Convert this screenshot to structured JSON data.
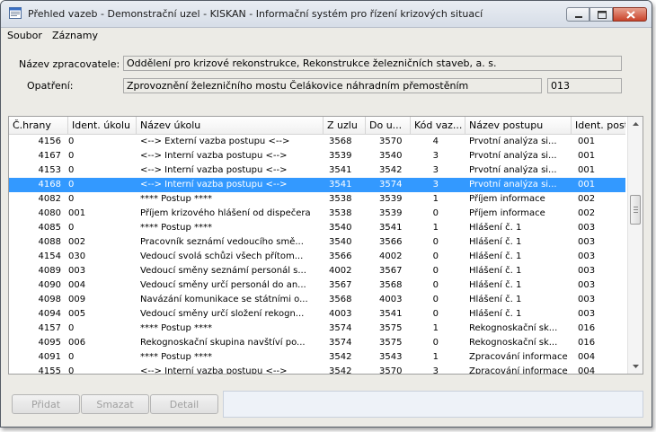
{
  "window": {
    "title": "Přehled vazeb - Demonstrační uzel - KISKAN - Informační systém pro řízení krizových situací"
  },
  "menu": {
    "items": [
      "Soubor",
      "Záznamy"
    ]
  },
  "form": {
    "zpracovatel_label": "Název zpracovatele:",
    "zpracovatel_value": "Oddělení pro krizové rekonstrukce, Rekonstrukce železničních staveb, a. s.",
    "opatreni_label": "Opatření:",
    "opatreni_value": "Zprovoznění železničního mostu Čelákovice náhradním přemostěním",
    "opatreni_code": "013"
  },
  "grid": {
    "columns": [
      "Č.hrany",
      "Ident. úkolu",
      "Název úkolu",
      "Z uzlu",
      "Do u...",
      "Kód vaz...",
      "Název postupu",
      "Ident. post"
    ],
    "selected_row": 3,
    "rows": [
      [
        "4156",
        "0",
        "<--> Externí vazba postupu <-->",
        "3568",
        "3570",
        "4",
        "Prvotní analýza si...",
        "001"
      ],
      [
        "4167",
        "0",
        "<--> Interní vazba postupu <-->",
        "3539",
        "3540",
        "3",
        "Prvotní analýza si...",
        "001"
      ],
      [
        "4153",
        "0",
        "<--> Interní vazba postupu <-->",
        "3541",
        "3542",
        "3",
        "Prvotní analýza si...",
        "001"
      ],
      [
        "4168",
        "0",
        "<--> Interní vazba postupu <-->",
        "3541",
        "3574",
        "3",
        "Prvotní analýza si...",
        "001"
      ],
      [
        "4082",
        "0",
        "**** Postup ****",
        "3538",
        "3539",
        "1",
        "Příjem informace",
        "002"
      ],
      [
        "4080",
        "001",
        "Příjem krizového hlášení od dispečera",
        "3538",
        "3539",
        "0",
        "Příjem informace",
        "002"
      ],
      [
        "4085",
        "0",
        "**** Postup ****",
        "3540",
        "3541",
        "1",
        "Hlášení č. 1",
        "003"
      ],
      [
        "4088",
        "002",
        "Pracovník seznámí vedoucího smě...",
        "3540",
        "3566",
        "0",
        "Hlášení č. 1",
        "003"
      ],
      [
        "4154",
        "030",
        "Vedoucí svolá schůzi všech přítom...",
        "3566",
        "4002",
        "0",
        "Hlášení č. 1",
        "003"
      ],
      [
        "4089",
        "003",
        "Vedoucí směny seznámí personál s...",
        "4002",
        "3567",
        "0",
        "Hlášení č. 1",
        "003"
      ],
      [
        "4090",
        "004",
        "Vedoucí směny určí personál do an...",
        "3567",
        "3568",
        "0",
        "Hlášení č. 1",
        "003"
      ],
      [
        "4098",
        "009",
        "Navázání komunikace se státními o...",
        "3568",
        "4003",
        "0",
        "Hlášení č. 1",
        "003"
      ],
      [
        "4094",
        "005",
        "Vedoucí směny určí složení rekogn...",
        "4003",
        "3541",
        "0",
        "Hlášení č. 1",
        "003"
      ],
      [
        "4157",
        "0",
        "**** Postup ****",
        "3574",
        "3575",
        "1",
        "Rekognoskační sk...",
        "016"
      ],
      [
        "4095",
        "006",
        "Rekognoskační skupina navštíví po...",
        "3574",
        "3575",
        "0",
        "Rekognoskační sk...",
        "016"
      ],
      [
        "4091",
        "0",
        "**** Postup ****",
        "3542",
        "3543",
        "1",
        "Zpracování informace",
        "004"
      ],
      [
        "4155",
        "0",
        "<--> Interní vazba postupu <-->",
        "3542",
        "3570",
        "3",
        "Zpracování informace",
        "004"
      ]
    ]
  },
  "buttons": {
    "pridat": "Přidat",
    "smazat": "Smazat",
    "detail": "Detail"
  }
}
